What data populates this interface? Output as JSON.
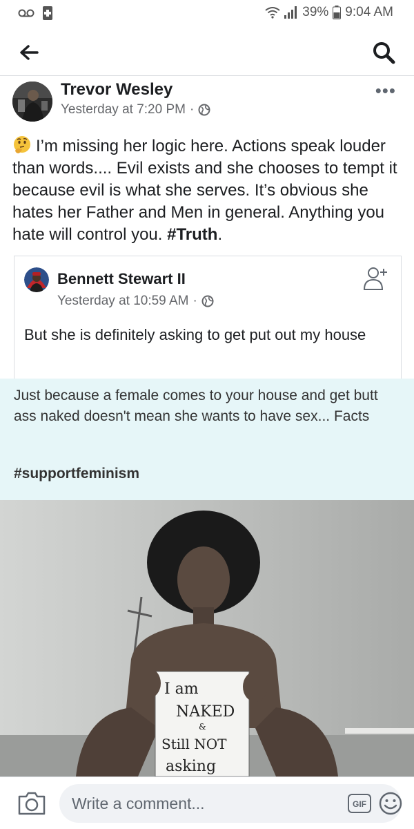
{
  "status_bar": {
    "battery": "39%",
    "time": "9:04 AM",
    "icons": [
      "voicemail-icon",
      "sim-icon",
      "wifi-icon",
      "signal-icon",
      "battery-icon"
    ]
  },
  "header": {
    "icons": [
      "back-arrow-icon",
      "search-icon"
    ]
  },
  "post": {
    "author": "Trevor Wesley",
    "timestamp": "Yesterday at 7:20 PM",
    "separator": "·",
    "privacy_icon": "globe-icon",
    "more_label": "•••",
    "text_main": "I’m missing her logic here. Actions speak louder than words.... Evil exists and she chooses to tempt it because evil is what she serves. It’s obvious she hates her Father and Men in general. Anything you hate will control you. ",
    "hashtag": "#Truth",
    "text_end": ".",
    "emoji": "thinking-face-icon"
  },
  "shared": {
    "author": "Bennett Stewart II",
    "timestamp": "Yesterday at 10:59 AM",
    "separator": "·",
    "privacy_icon": "globe-icon",
    "add_friend_icon": "add-friend-icon",
    "text": "But she is definitely asking to get put out my house"
  },
  "meme": {
    "caption": "Just because a female comes to your house and get butt ass naked doesn't mean she wants to have sex... Facts",
    "hashtag": "#supportfeminism",
    "sign_line1": "I am",
    "sign_line2": "NAKED",
    "sign_line3": "&",
    "sign_line4": "Still NOT",
    "sign_line5": "asking"
  },
  "comment_bar": {
    "placeholder": "Write a comment...",
    "gif_label": "GIF",
    "icons": [
      "camera-icon",
      "gif-icon",
      "emoji-icon"
    ]
  },
  "colors": {
    "text": "#1c1e21",
    "meta": "#65676b",
    "caption_bg": "#e6f6f8",
    "input_bg": "#f0f2f5"
  }
}
